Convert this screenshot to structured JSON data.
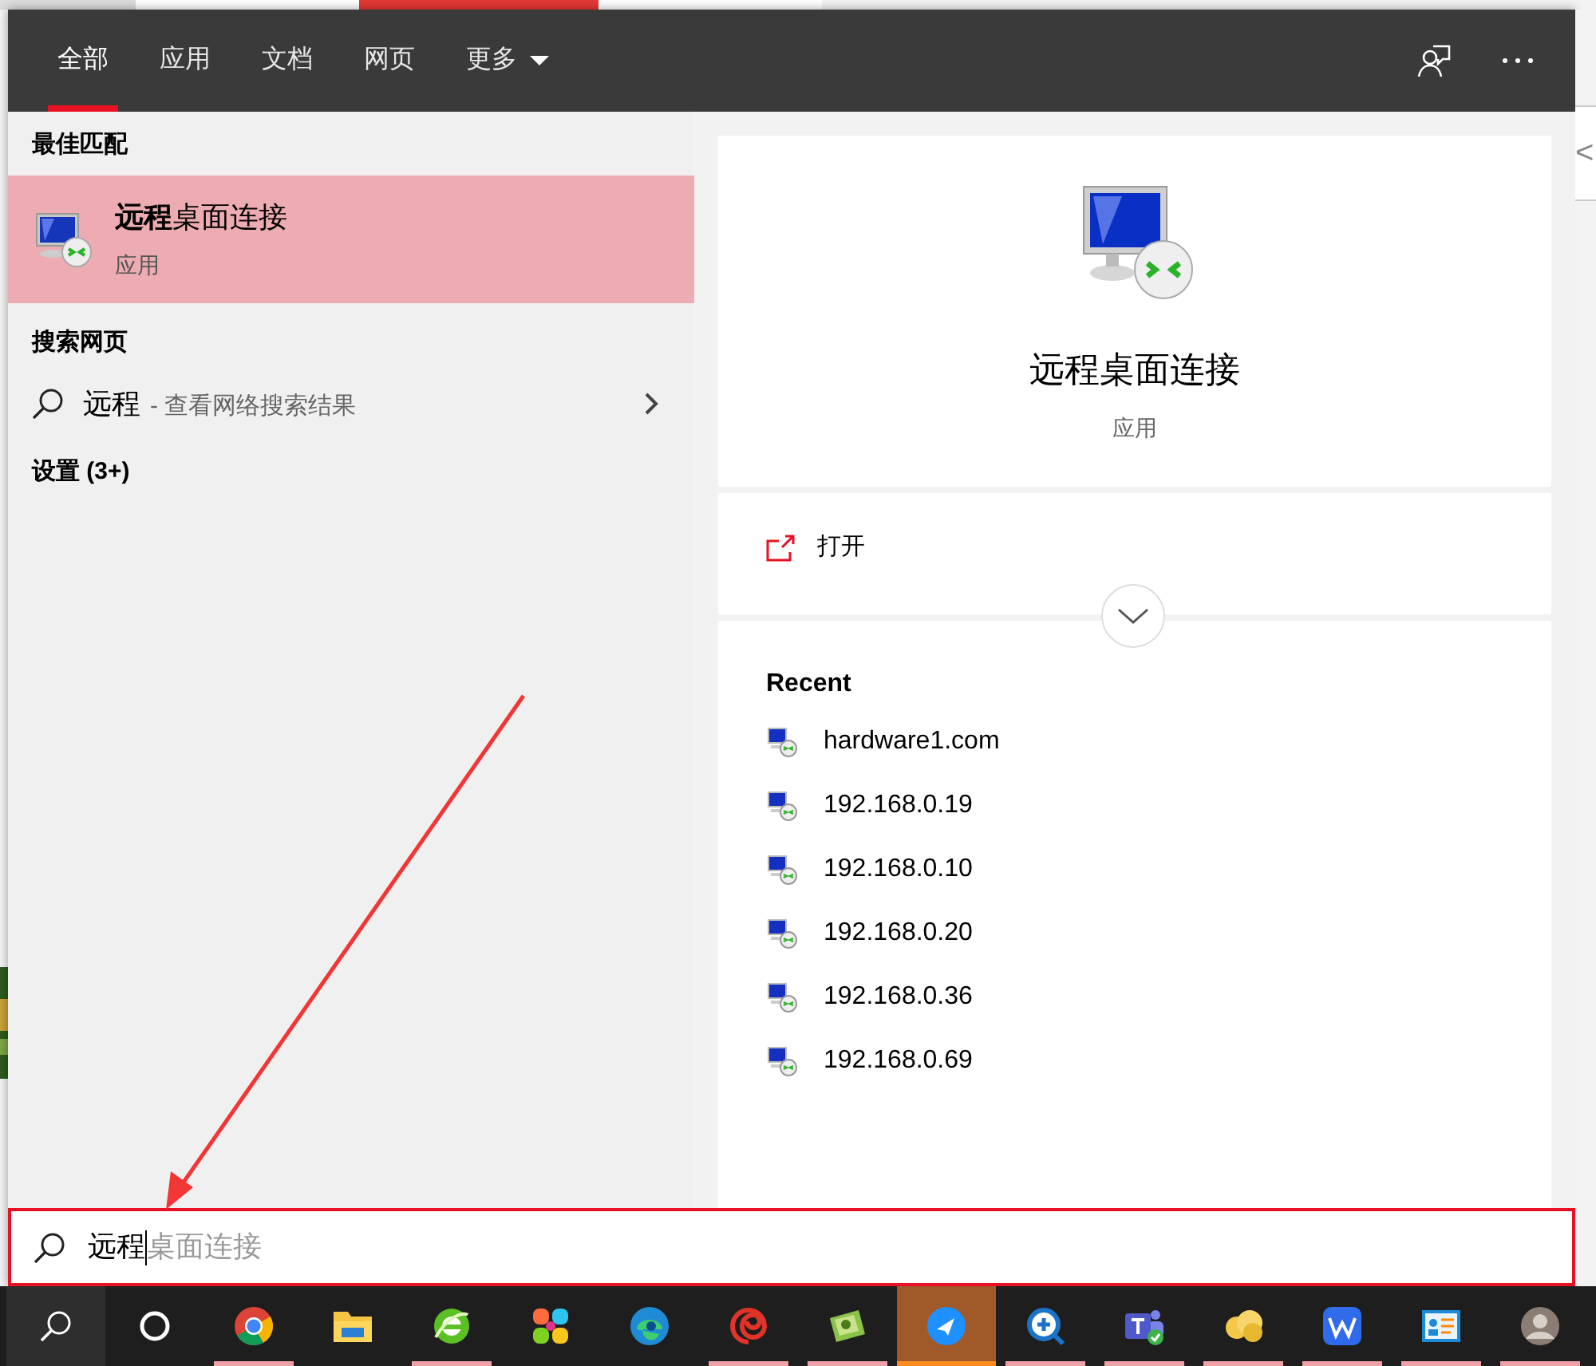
{
  "tabs": [
    {
      "label": "全部",
      "selected": true,
      "kind": "plain"
    },
    {
      "label": "应用",
      "selected": false,
      "kind": "plain"
    },
    {
      "label": "文档",
      "selected": false,
      "kind": "plain"
    },
    {
      "label": "网页",
      "selected": false,
      "kind": "plain"
    },
    {
      "label": "更多",
      "selected": false,
      "kind": "dropdown"
    }
  ],
  "best_match": {
    "heading": "最佳匹配",
    "title": "**远程**桌面连接",
    "subtitle": "应用",
    "selected": true
  },
  "web_search": {
    "heading": "搜索网页",
    "query": "远程",
    "hint": "- 查看网络搜索结果"
  },
  "settings": {
    "heading": "设置 (3+)"
  },
  "detail": {
    "title": "远程桌面连接",
    "subtitle": "应用",
    "actions": [
      {
        "label": "打开"
      }
    ],
    "recent_heading": "Recent",
    "recent": [
      "hardware1.com",
      "192.168.0.19",
      "192.168.0.10",
      "192.168.0.20",
      "192.168.0.36",
      "192.168.0.69"
    ]
  },
  "search_box": {
    "value": "远程",
    "suggestion": "桌面连接"
  },
  "background_window": {
    "text": "<"
  },
  "taskbar": [
    {
      "kind": "search",
      "active": false,
      "running": false
    },
    {
      "kind": "cortana",
      "active": false,
      "running": false
    },
    {
      "kind": "chrome",
      "active": false,
      "running": true
    },
    {
      "kind": "folder",
      "active": false,
      "running": false
    },
    {
      "kind": "ie",
      "active": false,
      "running": true
    },
    {
      "kind": "flower",
      "active": false,
      "running": false
    },
    {
      "kind": "edge",
      "active": false,
      "running": false
    },
    {
      "kind": "spiral",
      "active": false,
      "running": true
    },
    {
      "kind": "game",
      "active": false,
      "running": true
    },
    {
      "kind": "bird",
      "active": true,
      "running": false
    },
    {
      "kind": "magnifier",
      "active": false,
      "running": true
    },
    {
      "kind": "teams",
      "active": false,
      "running": true
    },
    {
      "kind": "cloud",
      "active": false,
      "running": true
    },
    {
      "kind": "wps",
      "active": false,
      "running": true
    },
    {
      "kind": "idcard",
      "active": false,
      "running": true
    },
    {
      "kind": "avatar",
      "active": false,
      "running": true
    }
  ]
}
